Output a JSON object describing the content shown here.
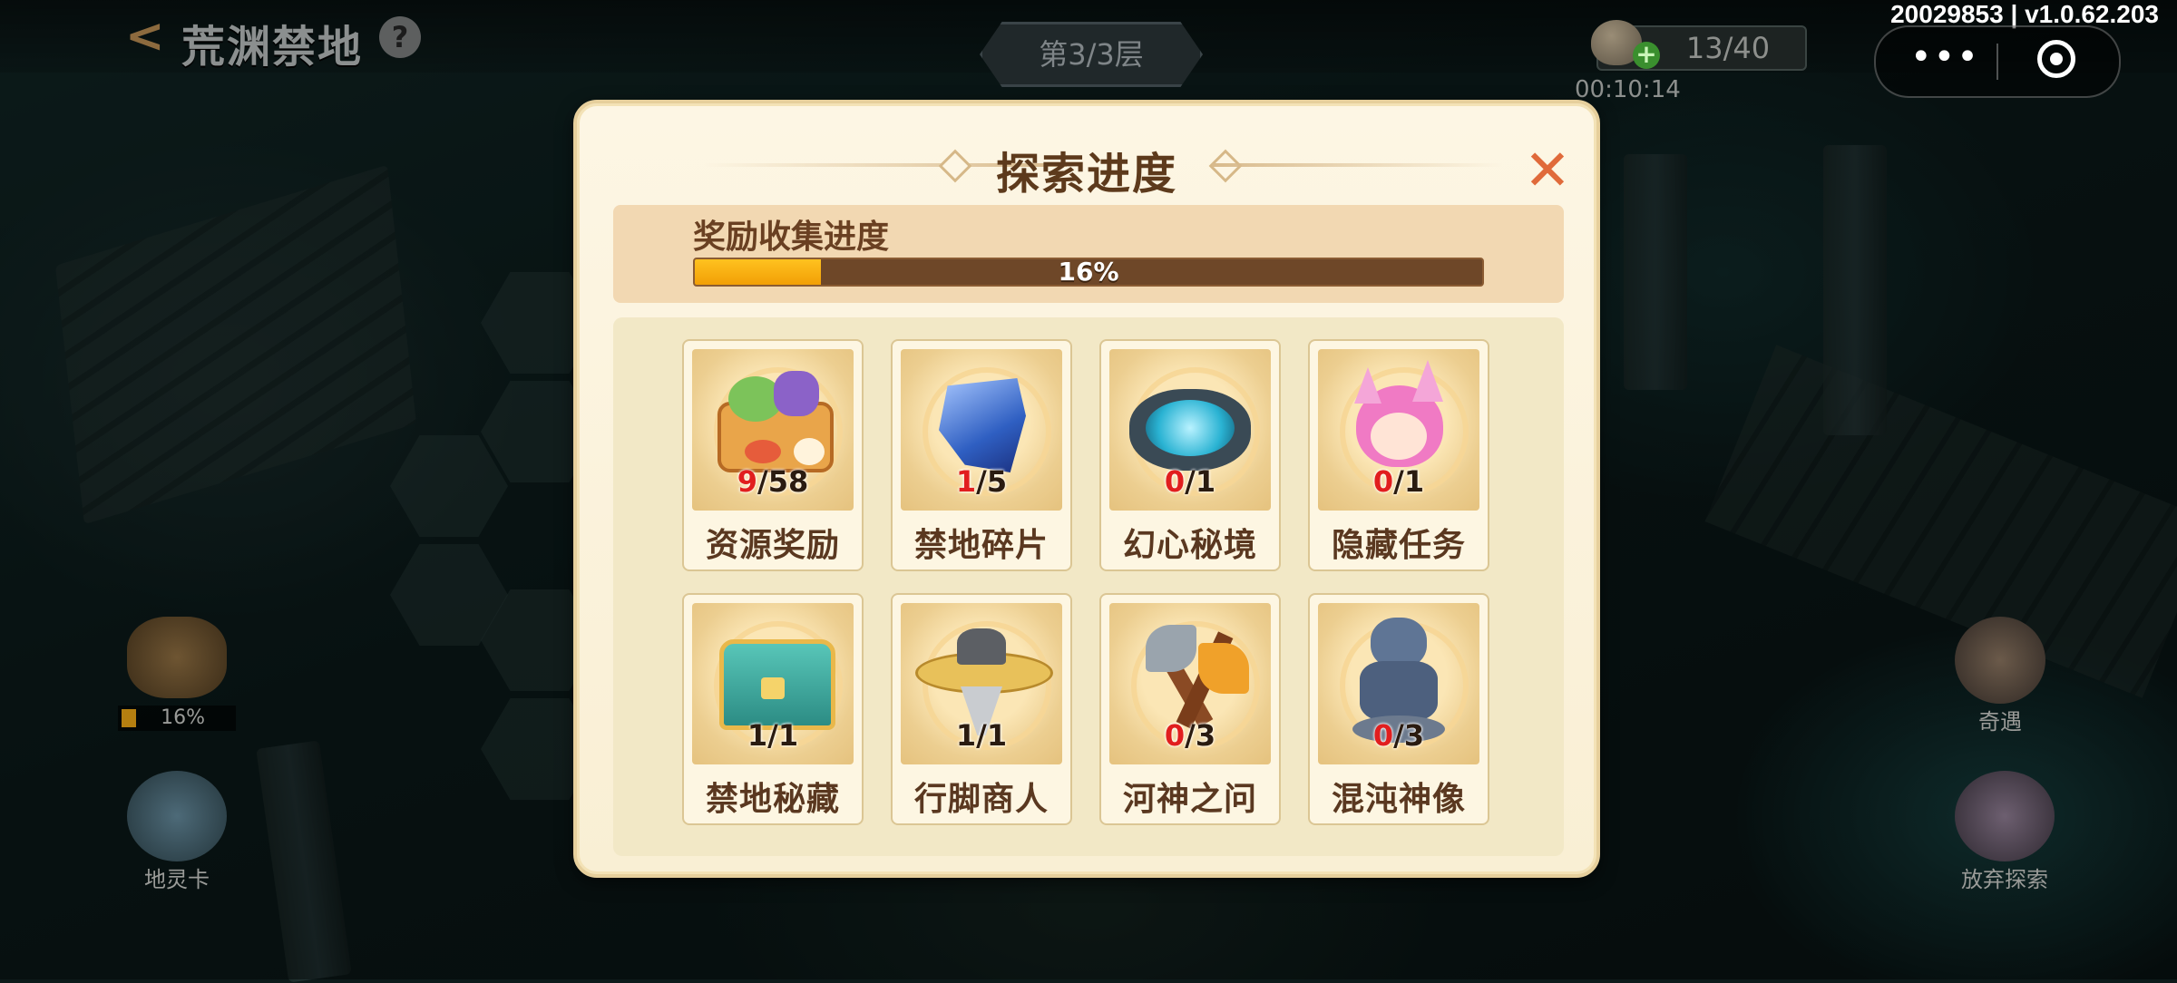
{
  "header": {
    "back_glyph": "<",
    "title": "荒渊禁地",
    "help_glyph": "?",
    "floor": "第3/3层",
    "energy_count": "13/40",
    "energy_plus": "+",
    "timer": "00:10:14",
    "version": "20029853 | v1.0.62.203",
    "more_glyph": "•••"
  },
  "side": {
    "progress_mini": "16%",
    "progress_mini_value": 0.16,
    "spirit_card": "地灵卡",
    "encounter": "奇遇",
    "abandon": "放弃探索"
  },
  "modal": {
    "title": "探索进度",
    "close_glyph": "✕",
    "reward_label": "奖励收集进度",
    "progress_text": "16%",
    "progress_value": 0.16,
    "items": [
      {
        "name": "资源奖励",
        "current": "9",
        "total": "58",
        "highlight": true,
        "icon": "treasure-bundle-icon"
      },
      {
        "name": "禁地碎片",
        "current": "1",
        "total": "5",
        "highlight": true,
        "icon": "blue-shard-icon"
      },
      {
        "name": "幻心秘境",
        "current": "0",
        "total": "1",
        "highlight": true,
        "icon": "portal-stone-icon"
      },
      {
        "name": "隐藏任务",
        "current": "0",
        "total": "1",
        "highlight": true,
        "icon": "pink-fox-girl-icon"
      },
      {
        "name": "禁地秘藏",
        "current": "1",
        "total": "1",
        "highlight": false,
        "icon": "treasure-chest-icon"
      },
      {
        "name": "行脚商人",
        "current": "1",
        "total": "1",
        "highlight": false,
        "icon": "straw-hat-merchant-icon"
      },
      {
        "name": "河神之问",
        "current": "0",
        "total": "3",
        "highlight": true,
        "icon": "axes-icon"
      },
      {
        "name": "混沌神像",
        "current": "0",
        "total": "3",
        "highlight": true,
        "icon": "chaos-statue-icon"
      }
    ]
  },
  "colors": {
    "accent_orange": "#f29f06",
    "count_red": "#e11e1e",
    "title_brown": "#5d3a1c",
    "close_orange": "#e06a3a"
  }
}
